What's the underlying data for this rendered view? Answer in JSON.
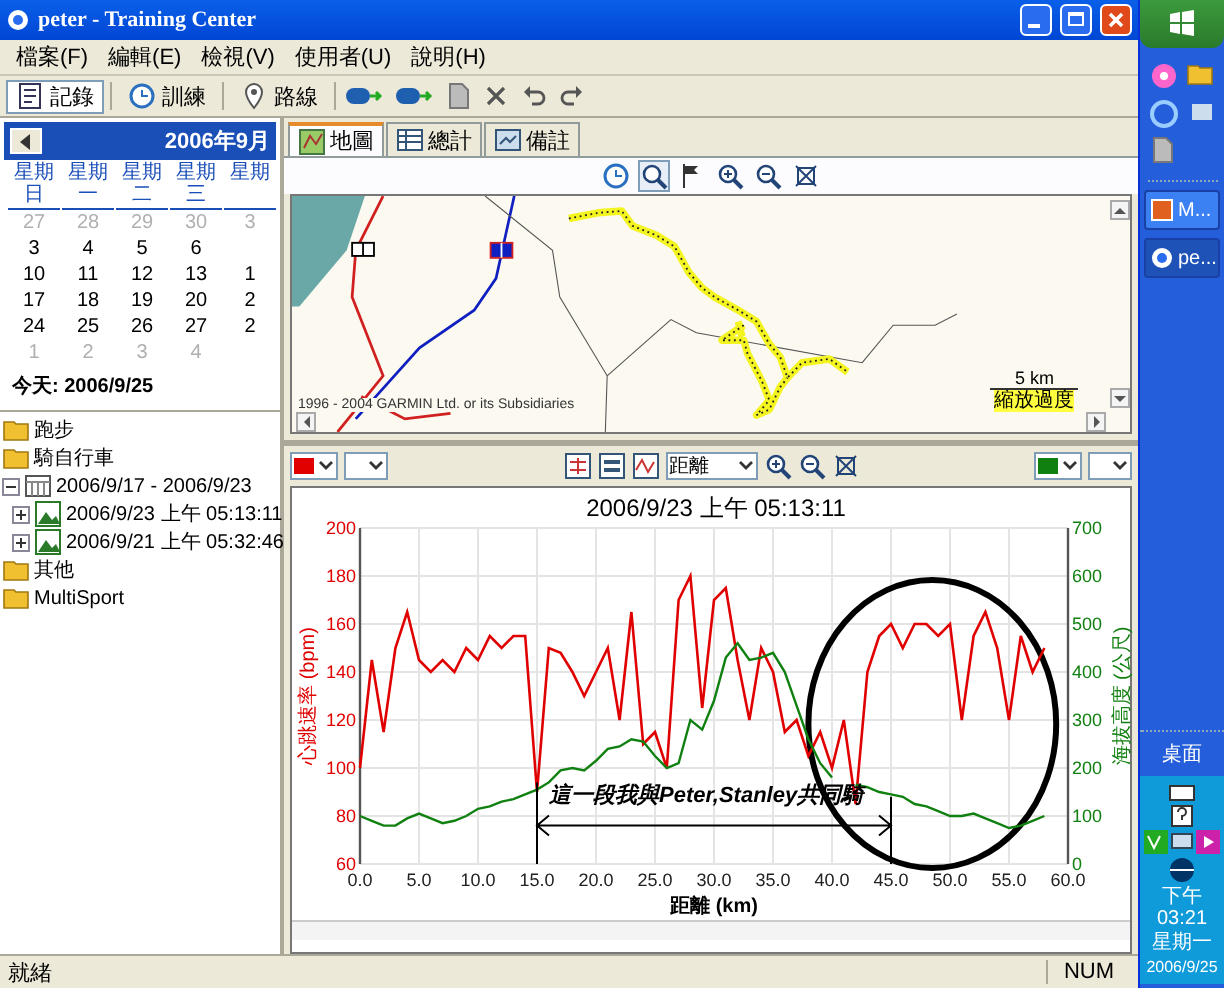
{
  "window": {
    "title": "peter - Training Center"
  },
  "menu": [
    "檔案(F)",
    "編輯(E)",
    "檢視(V)",
    "使用者(U)",
    "說明(H)"
  ],
  "toolbar": [
    {
      "label": "記錄",
      "selected": true
    },
    {
      "label": "訓練",
      "selected": false
    },
    {
      "label": "路線",
      "selected": false
    }
  ],
  "calendar": {
    "month": "2006年9月",
    "weekdays": [
      "星期日",
      "星期一",
      "星期二",
      "星期三",
      "星期"
    ],
    "weeks": [
      [
        {
          "day": "27",
          "other_month": true
        },
        {
          "day": "28",
          "other_month": true
        },
        {
          "day": "29",
          "other_month": true
        },
        {
          "day": "30",
          "other_month": true
        },
        {
          "day": "3",
          "other_month": true
        }
      ],
      [
        {
          "day": "3",
          "other_month": false
        },
        {
          "day": "4",
          "other_month": false
        },
        {
          "day": "5",
          "other_month": false
        },
        {
          "day": "6",
          "other_month": false
        }
      ],
      [
        {
          "day": "10",
          "other_month": false
        },
        {
          "day": "11",
          "other_month": false
        },
        {
          "day": "12",
          "other_month": false
        },
        {
          "day": "13",
          "other_month": false
        },
        {
          "day": "1",
          "other_month": false
        }
      ],
      [
        {
          "day": "17",
          "other_month": false
        },
        {
          "day": "18",
          "other_month": false
        },
        {
          "day": "19",
          "other_month": false
        },
        {
          "day": "20",
          "other_month": false
        },
        {
          "day": "2",
          "other_month": false
        }
      ],
      [
        {
          "day": "24",
          "other_month": false
        },
        {
          "day": "25",
          "other_month": false
        },
        {
          "day": "26",
          "other_month": false
        },
        {
          "day": "27",
          "other_month": false
        },
        {
          "day": "2",
          "other_month": false
        }
      ],
      [
        {
          "day": "1",
          "other_month": true
        },
        {
          "day": "2",
          "other_month": true
        },
        {
          "day": "3",
          "other_month": true
        },
        {
          "day": "4",
          "other_month": true
        }
      ]
    ],
    "today": "今天: 2006/9/25"
  },
  "tree": [
    {
      "label": "跑步",
      "kind": "folder"
    },
    {
      "label": "騎自行車",
      "kind": "folder"
    },
    {
      "label": "2006/9/17 - 2006/9/23",
      "kind": "week",
      "expanded": true,
      "children": [
        {
          "label": "2006/9/23 上午 05:13:11",
          "kind": "activity",
          "expanded": false
        },
        {
          "label": "2006/9/21 上午 05:32:46",
          "kind": "activity",
          "expanded": false
        }
      ]
    },
    {
      "label": "其他",
      "kind": "folder"
    },
    {
      "label": "MultiSport",
      "kind": "folder"
    }
  ],
  "tabs": [
    {
      "label": "地圖",
      "selected": true
    },
    {
      "label": "總計",
      "selected": false
    },
    {
      "label": "備註",
      "selected": false
    }
  ],
  "map": {
    "copyright": "1996 - 2004 GARMIN Ltd. or its Subsidiaries",
    "scale": "5 km",
    "zoom_warning": "縮放過度"
  },
  "chart_toolbar": {
    "x_axis": "距離"
  },
  "chart": {
    "chart_data": {
      "type": "line",
      "title": "2006/9/23 上午 05:13:11",
      "xlabel": "距離 (km)",
      "ylabel": "心跳速率 (bpm)",
      "y2label": "海拔高度 (公尺)",
      "x": [
        0,
        1,
        2,
        3,
        4,
        5,
        6,
        7,
        8,
        9,
        10,
        11,
        12,
        13,
        14,
        15,
        16,
        17,
        18,
        19,
        20,
        21,
        22,
        23,
        24,
        25,
        26,
        27,
        28,
        29,
        30,
        31,
        32,
        33,
        34,
        35,
        36,
        37,
        38,
        39,
        40,
        41,
        42,
        43,
        44,
        45,
        46,
        47,
        48,
        49,
        50,
        51,
        52,
        53,
        54,
        55,
        56,
        57,
        58
      ],
      "series": [
        {
          "color": "#e00000",
          "values": [
            100,
            145,
            115,
            150,
            165,
            145,
            140,
            145,
            140,
            150,
            145,
            155,
            150,
            155,
            155,
            90,
            150,
            148,
            140,
            130,
            140,
            150,
            120,
            165,
            110,
            115,
            100,
            170,
            180,
            125,
            170,
            175,
            145,
            120,
            150,
            140,
            115,
            120,
            105,
            115,
            100,
            120,
            85,
            140,
            155,
            160,
            150,
            160,
            160,
            155,
            160,
            120,
            155,
            165,
            150,
            120,
            155,
            140,
            150
          ]
        },
        {
          "color": "#108010",
          "axis": "y2",
          "values": [
            100,
            90,
            80,
            80,
            95,
            105,
            95,
            85,
            90,
            100,
            115,
            120,
            130,
            135,
            145,
            155,
            170,
            195,
            200,
            195,
            215,
            240,
            245,
            260,
            255,
            225,
            200,
            210,
            300,
            280,
            340,
            430,
            460,
            425,
            430,
            440,
            400,
            330,
            260,
            210,
            180,
            null,
            165,
            160,
            150,
            145,
            140,
            125,
            120,
            110,
            100,
            100,
            105,
            95,
            85,
            75,
            80,
            90,
            100
          ]
        }
      ],
      "xlim": [
        0,
        60
      ],
      "ylim": [
        60,
        200
      ],
      "y2lim": [
        0,
        700
      ],
      "xticks": [
        {
          "value": 0,
          "label": "0.0"
        },
        {
          "value": 5,
          "label": "5.0"
        },
        {
          "value": 10,
          "label": "10.0"
        },
        {
          "value": 15,
          "label": "15.0"
        },
        {
          "value": 20,
          "label": "20.0"
        },
        {
          "value": 25,
          "label": "25.0"
        },
        {
          "value": 30,
          "label": "30.0"
        },
        {
          "value": 35,
          "label": "35.0"
        },
        {
          "value": 40,
          "label": "40.0"
        },
        {
          "value": 45,
          "label": "45.0"
        },
        {
          "value": 50,
          "label": "50.0"
        },
        {
          "value": 55,
          "label": "55.0"
        },
        {
          "value": 60,
          "label": "60.0"
        }
      ],
      "yticks": [
        60,
        80,
        100,
        120,
        140,
        160,
        180,
        200
      ],
      "y2ticks": [
        0,
        100,
        200,
        300,
        400,
        500,
        600,
        700
      ],
      "grid": true,
      "ref_lines": [
        {
          "axis": "x",
          "value": 15
        },
        {
          "axis": "x",
          "value": 45
        }
      ],
      "annotations": [
        "這一段我與Peter,Stanley共同騎"
      ]
    }
  },
  "status_bar": {
    "text": "就緒",
    "indicator": "NUM"
  },
  "taskbar": {
    "tasks": [
      {
        "label": "M..."
      },
      {
        "label": "pe..."
      }
    ],
    "desktop": "桌面",
    "clock": [
      "下午 03:21",
      "星期一",
      "2006/9/25"
    ]
  }
}
